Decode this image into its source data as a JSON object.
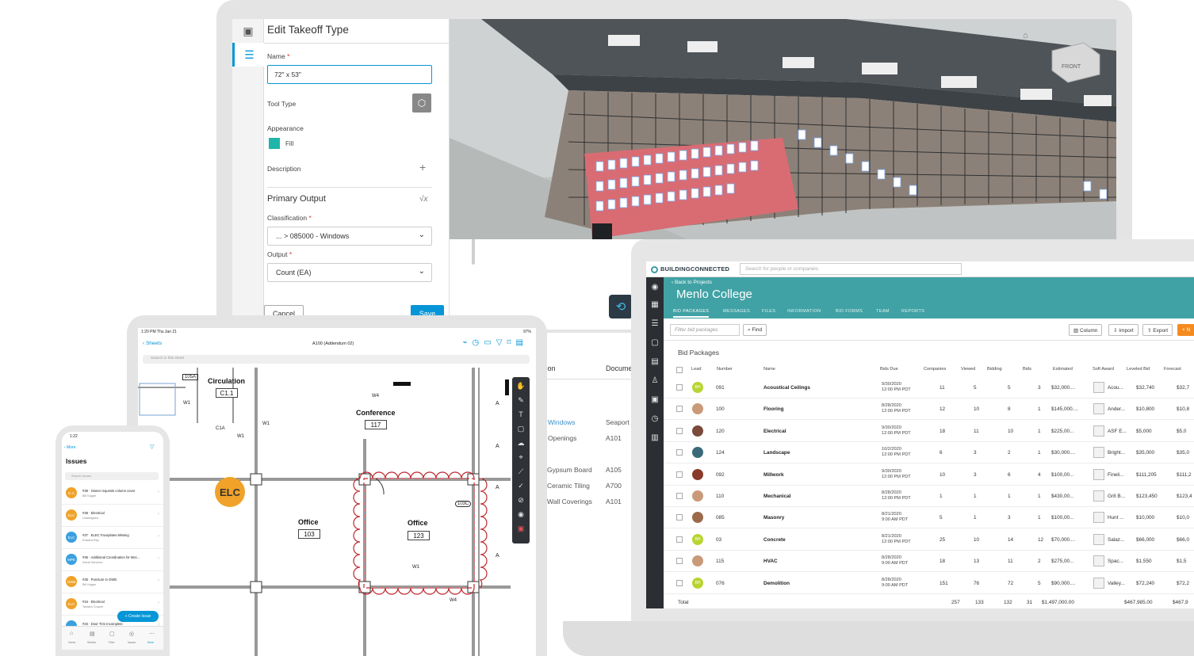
{
  "takeoff": {
    "title": "Edit Takeoff Type",
    "name_label": "Name",
    "name_value": "72\" x 53\"",
    "tool_type_label": "Tool Type",
    "appearance_label": "Appearance",
    "fill_label": "Fill",
    "description_label": "Description",
    "primary_output_title": "Primary Output",
    "classification_label": "Classification",
    "classification_value": "... > 085000 - Windows",
    "output_label": "Output",
    "output_value": "Count (EA)",
    "cancel_label": "Cancel",
    "save_label": "Save",
    "required_mark": "*",
    "fill_color": "#1fb5a8"
  },
  "doc_list": {
    "col_name": "tion",
    "col_doc": "Docume",
    "rows": [
      {
        "name": "Windows",
        "doc": "Seaport"
      },
      {
        "name": "Openings",
        "doc": "A101"
      },
      {
        "name": "Gypsum Board",
        "doc": "A105"
      },
      {
        "name": "Ceramic Tiling",
        "doc": "A700"
      },
      {
        "name": "Wall Coverings",
        "doc": "A101"
      }
    ]
  },
  "viewer_3d": {
    "cube_label": "FRONT"
  },
  "bc": {
    "logo_text": "BUILDINGCONNECTED",
    "search_placeholder": "Search for people or companies",
    "back_link": "‹ Back to Projects",
    "project_title": "Menlo College",
    "tabs": [
      "BID PACKAGES",
      "MESSAGES",
      "FILES",
      "INFORMATION",
      "BID FORMS",
      "TEAM",
      "REPORTS"
    ],
    "filter_placeholder": "Filter bid packages",
    "find_label": "Find",
    "column_label": "Column",
    "import_label": "Import",
    "export_label": "Export",
    "new_label": "+ N",
    "section_title": "Bid Packages",
    "headers": [
      "Lead",
      "Number",
      "Name",
      "Bids Due",
      "Companies",
      "Viewed",
      "Bidding",
      "Bids",
      "Estimated",
      "Soft Award",
      "Leveled Bid",
      "Forecast"
    ],
    "rows": [
      {
        "lead": "BH",
        "lead_color": "#b8d432",
        "number": "091",
        "name": "Acoustical Ceilings",
        "due1": "9/30/2020",
        "due2": "12:00 PM PDT",
        "companies": "11",
        "viewed": "5",
        "bidding": "5",
        "bids": "3",
        "estimated": "$32,000....",
        "award": "Acou...",
        "leveled": "$32,740",
        "forecast": "$32,7"
      },
      {
        "lead": "",
        "lead_color": "#c99a7a",
        "number": "100",
        "name": "Flooring",
        "due1": "8/28/2020",
        "due2": "12:00 PM PDT",
        "companies": "12",
        "viewed": "10",
        "bidding": "8",
        "bids": "1",
        "estimated": "$145,000....",
        "award": "Ander...",
        "leveled": "$10,800",
        "forecast": "$10,8"
      },
      {
        "lead": "",
        "lead_color": "#7a4a3a",
        "number": "120",
        "name": "Electrical",
        "due1": "9/30/2020",
        "due2": "12:00 PM PDT",
        "companies": "18",
        "viewed": "11",
        "bidding": "10",
        "bids": "1",
        "estimated": "$225,00...",
        "award": "ASF E...",
        "leveled": "$5,000",
        "forecast": "$5,0"
      },
      {
        "lead": "",
        "lead_color": "#3a6a7a",
        "number": "124",
        "name": "Landscape",
        "due1": "10/2/2020",
        "due2": "12:00 PM PDT",
        "companies": "6",
        "viewed": "3",
        "bidding": "2",
        "bids": "1",
        "estimated": "$30,000....",
        "award": "Bright...",
        "leveled": "$35,000",
        "forecast": "$35,0"
      },
      {
        "lead": "",
        "lead_color": "#8a3a2a",
        "number": "092",
        "name": "Millwork",
        "due1": "9/30/2020",
        "due2": "12:00 PM PDT",
        "companies": "10",
        "viewed": "3",
        "bidding": "6",
        "bids": "4",
        "estimated": "$100,00...",
        "award": "Fineli...",
        "leveled": "$111,205",
        "forecast": "$111,2"
      },
      {
        "lead": "",
        "lead_color": "#c99a7a",
        "number": "110",
        "name": "Mechanical",
        "due1": "8/28/2020",
        "due2": "12:00 PM PDT",
        "companies": "1",
        "viewed": "1",
        "bidding": "1",
        "bids": "1",
        "estimated": "$430,00...",
        "award": "Gr8 B...",
        "leveled": "$123,450",
        "forecast": "$123,4"
      },
      {
        "lead": "",
        "lead_color": "#9a6a4a",
        "number": "085",
        "name": "Masonry",
        "due1": "8/21/2020",
        "due2": "9:00 AM PDT",
        "companies": "5",
        "viewed": "1",
        "bidding": "3",
        "bids": "1",
        "estimated": "$100,00...",
        "award": "Hunt ...",
        "leveled": "$10,000",
        "forecast": "$10,0"
      },
      {
        "lead": "BH",
        "lead_color": "#b8d432",
        "number": "03",
        "name": "Concrete",
        "due1": "8/21/2020",
        "due2": "12:00 PM PDT",
        "companies": "25",
        "viewed": "10",
        "bidding": "14",
        "bids": "12",
        "estimated": "$70,000....",
        "award": "Salaz...",
        "leveled": "$66,000",
        "forecast": "$66,0"
      },
      {
        "lead": "",
        "lead_color": "#c99a7a",
        "number": "115",
        "name": "HVAC",
        "due1": "8/28/2020",
        "due2": "9:00 AM PDT",
        "companies": "18",
        "viewed": "13",
        "bidding": "11",
        "bids": "2",
        "estimated": "$275,00...",
        "award": "Spac...",
        "leveled": "$1,550",
        "forecast": "$1,5"
      },
      {
        "lead": "BH",
        "lead_color": "#b8d432",
        "number": "076",
        "name": "Demolition",
        "due1": "8/28/2020",
        "due2": "9:00 AM PDT",
        "companies": "151",
        "viewed": "76",
        "bidding": "72",
        "bids": "5",
        "estimated": "$90,000....",
        "award": "Valley...",
        "leveled": "$72,240",
        "forecast": "$72,2"
      }
    ],
    "totals": {
      "label": "Total",
      "companies": "257",
      "viewed": "133",
      "bidding": "132",
      "bids": "31",
      "estimated": "$1,497,000.00",
      "leveled": "$467,985.00",
      "forecast": "$467,9"
    }
  },
  "tablet": {
    "status_time": "1:20 PM  Thu Jan 21",
    "status_right": "97%",
    "back_label": "‹ Sheets",
    "sheet_title": "A100 (Addendum 02)",
    "search_placeholder": "Search in this sheet",
    "elc_label": "ELC",
    "rooms": [
      {
        "name": "Circulation",
        "num": "C1.1"
      },
      {
        "name": "Conference",
        "num": "117"
      },
      {
        "name": "Office",
        "num": "103"
      },
      {
        "name": "Office",
        "num": "123"
      }
    ],
    "tags": [
      "105A",
      "W1",
      "C1A",
      "W1",
      "W1",
      "W4",
      "103C",
      "W1",
      "W4",
      "A",
      "A",
      "A",
      "A"
    ]
  },
  "phone": {
    "time": "1:22",
    "back_label": "‹ More",
    "title": "Issues",
    "search_placeholder": "Search issues",
    "create_label": "+ Create Issue",
    "issues": [
      {
        "initials": "E-A",
        "color": "#f0a229",
        "title": "#39 · Owner requests column cover",
        "sub": "Bill Kagan"
      },
      {
        "initials": "ELC",
        "color": "#f0a229",
        "title": "#38 · Electrical",
        "sub": "Unassigned"
      },
      {
        "initials": "ELC",
        "color": "#3aa0e0",
        "title": "#37 · ELEC Faceplates Missing",
        "sub": "Edward Ray"
      },
      {
        "initials": "MPE",
        "color": "#3aa0e0",
        "title": "#36 · Additional Coordination for Mec...",
        "sub": "David Sanchez"
      },
      {
        "initials": "GWB",
        "color": "#f0a229",
        "title": "#35 · Puncture in GWB",
        "sub": "Bill Kagan"
      },
      {
        "initials": "ELC",
        "color": "#f0a229",
        "title": "#34 · Electrical",
        "sub": "Tamara Cooper"
      },
      {
        "initials": "",
        "color": "#3aa0e0",
        "title": "#33 · Door Trim Incomplete",
        "sub": ""
      }
    ],
    "tabs": [
      "Home",
      "Sheets",
      "Files",
      "Issues",
      "More"
    ]
  }
}
